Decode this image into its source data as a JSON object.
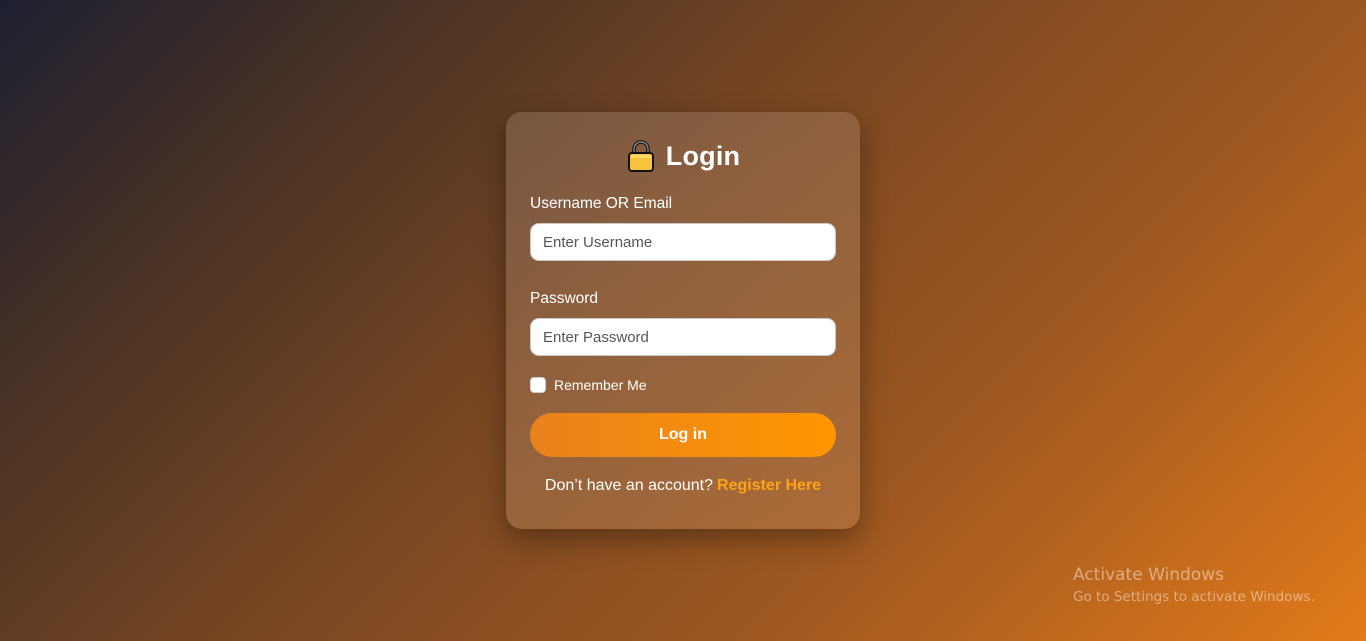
{
  "login_card": {
    "title": "Login",
    "title_icon": "lock-icon",
    "username": {
      "label": "Username OR Email",
      "value": "",
      "placeholder": "Enter Username"
    },
    "password": {
      "label": "Password",
      "value": "",
      "placeholder": "Enter Password"
    },
    "remember_me": {
      "label": "Remember Me",
      "checked": false
    },
    "login_button_label": "Log in",
    "register_prompt": "Don’t have an account?",
    "register_link_label": "Register Here"
  },
  "watermark": {
    "title": "Activate Windows",
    "subtitle": "Go to Settings to activate Windows."
  },
  "colors": {
    "accent": "#ff9600",
    "link": "#ffa315",
    "lock_body": "#f9c23c"
  }
}
